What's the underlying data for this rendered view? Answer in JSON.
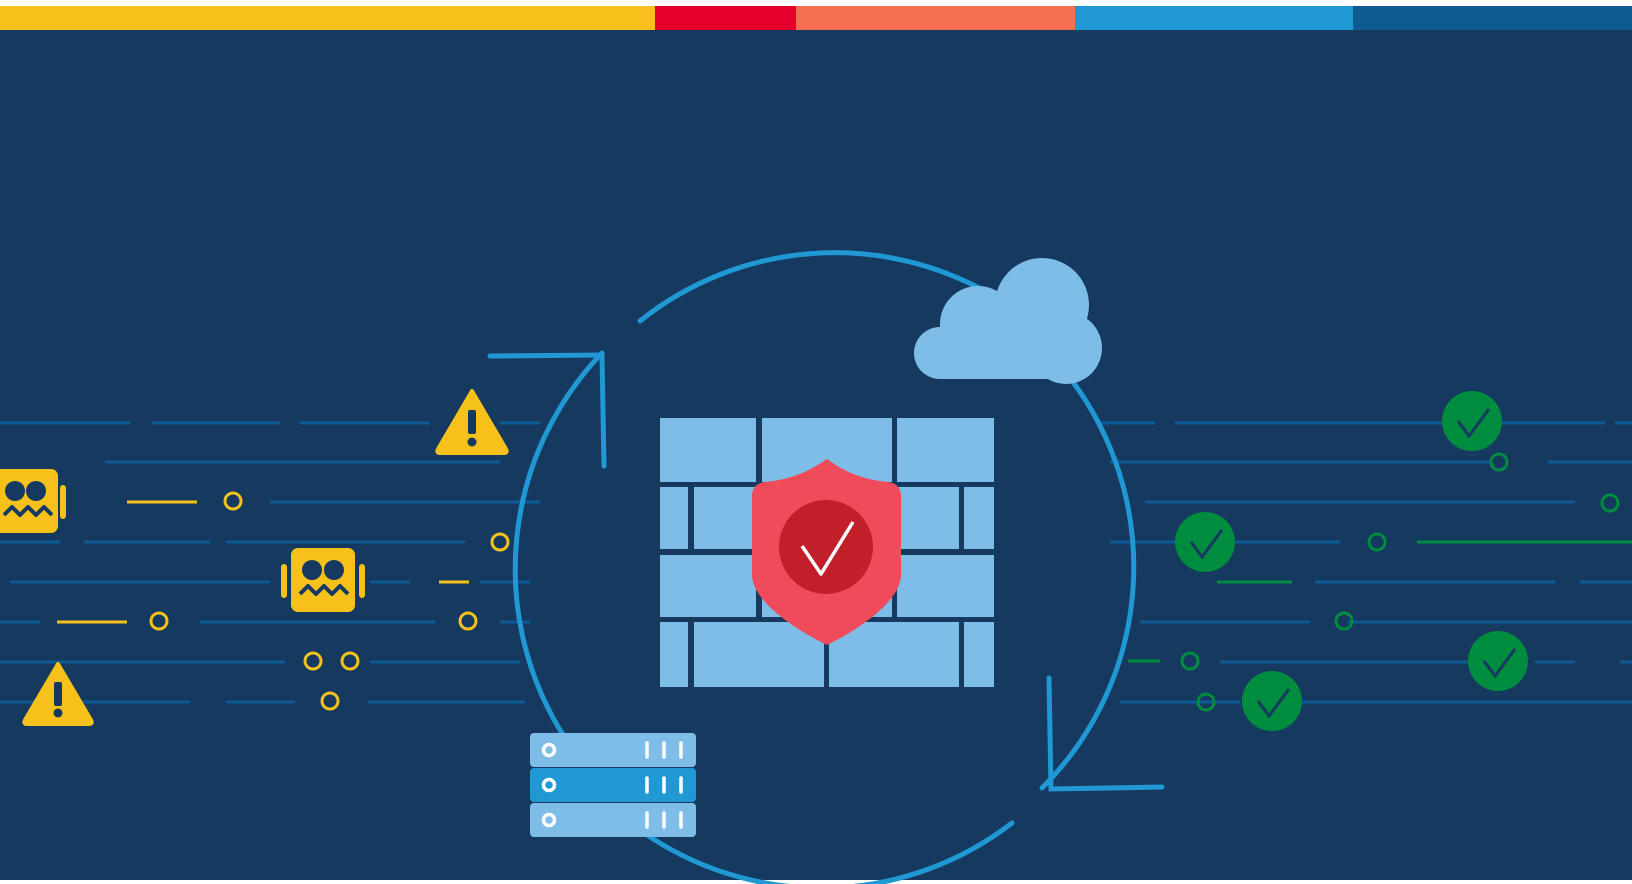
{
  "palette": {
    "background": "#15395f",
    "top_bar": [
      "#f5c11a",
      "#e4002b",
      "#f5704f",
      "#1f98d4",
      "#0f5a90"
    ],
    "lane": "#0d5b94",
    "threat": "#f5c11a",
    "safe": "#008c3f",
    "orbit": "#1f98d4",
    "light_blue": "#7fbde9",
    "shield": "#ef4b5a",
    "shield_inner": "#c1202b"
  },
  "illustration": {
    "left_icons": [
      "bug-icon",
      "bug-icon",
      "warning-icon",
      "warning-icon"
    ],
    "center_icons": [
      "firewall-icon",
      "shield-check-icon",
      "cloud-icon",
      "server-icon",
      "refresh-arrows-icon"
    ],
    "right_icons": [
      "check-circle-icon",
      "check-circle-icon",
      "check-circle-icon",
      "check-circle-icon"
    ]
  }
}
